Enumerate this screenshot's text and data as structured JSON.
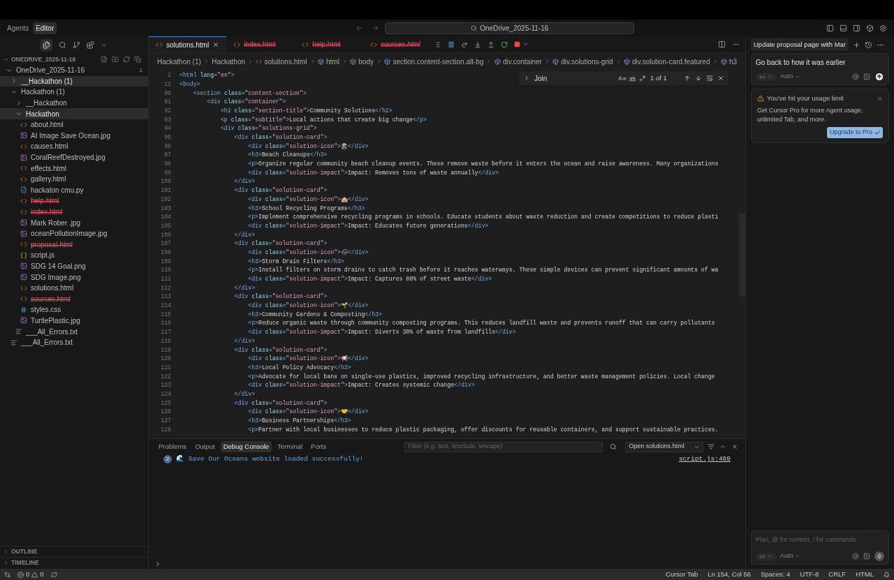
{
  "top_bar": {
    "modes": [
      {
        "label": "Agents",
        "selected": false
      },
      {
        "label": "Editor",
        "selected": true
      }
    ],
    "search": {
      "value": "OneDrive_2025-11-16"
    }
  },
  "explorer": {
    "title": "ONEDRIVE_2025-11-16",
    "tree": [
      {
        "label": "OneDrive_2025-11-16",
        "kind": "folder",
        "expanded": true,
        "selected": false,
        "badge": "1",
        "children": [
          {
            "label": "__Hackathon (1)",
            "kind": "folder",
            "expanded": false,
            "selected": true
          },
          {
            "label": "Hackathon (1)",
            "kind": "folder",
            "expanded": true,
            "selected": false,
            "children": [
              {
                "label": "__Hackathon",
                "kind": "folder",
                "expanded": false,
                "selected": false
              },
              {
                "label": "Hackathon",
                "kind": "folder",
                "expanded": true,
                "selected": true,
                "children": [
                  {
                    "label": "about.html",
                    "kind": "html",
                    "deleted": false,
                    "selected": false
                  },
                  {
                    "label": "AI Image Save Ocean.jpg",
                    "kind": "image",
                    "deleted": false,
                    "selected": false
                  },
                  {
                    "label": "causes.html",
                    "kind": "html",
                    "deleted": false,
                    "selected": false
                  },
                  {
                    "label": "CoralReefDestroyed.jpg",
                    "kind": "image",
                    "deleted": false,
                    "selected": false
                  },
                  {
                    "label": "effects.html",
                    "kind": "html",
                    "deleted": false,
                    "selected": false
                  },
                  {
                    "label": "gallery.html",
                    "kind": "html",
                    "deleted": false,
                    "selected": false
                  },
                  {
                    "label": "hackaton cmu.py",
                    "kind": "python",
                    "deleted": false,
                    "selected": false
                  },
                  {
                    "label": "help.html",
                    "kind": "html",
                    "deleted": true,
                    "selected": false
                  },
                  {
                    "label": "index.html",
                    "kind": "html",
                    "deleted": true,
                    "selected": false
                  },
                  {
                    "label": "Mark Rober .jpg",
                    "kind": "image",
                    "deleted": false,
                    "selected": false
                  },
                  {
                    "label": "oceanPollutionImage.jpg",
                    "kind": "image",
                    "deleted": false,
                    "selected": false
                  },
                  {
                    "label": "proposal.html",
                    "kind": "html",
                    "deleted": true,
                    "selected": false
                  },
                  {
                    "label": "script.js",
                    "kind": "js",
                    "deleted": false,
                    "selected": false
                  },
                  {
                    "label": "SDG 14 Goal.png",
                    "kind": "image",
                    "deleted": false,
                    "selected": false
                  },
                  {
                    "label": "SDG Image.png",
                    "kind": "image",
                    "deleted": false,
                    "selected": false
                  },
                  {
                    "label": "solutions.html",
                    "kind": "html",
                    "deleted": false,
                    "selected": false
                  },
                  {
                    "label": "sources.html",
                    "kind": "html",
                    "deleted": true,
                    "selected": false
                  },
                  {
                    "label": "styles.css",
                    "kind": "css",
                    "deleted": false,
                    "selected": false
                  },
                  {
                    "label": "TurtlePlastic.jpg",
                    "kind": "image",
                    "deleted": false,
                    "selected": false
                  }
                ]
              },
              {
                "label": "___All_Errors.txt",
                "kind": "text",
                "deleted": false,
                "selected": false
              }
            ]
          },
          {
            "label": "___All_Errors.txt",
            "kind": "text",
            "deleted": false,
            "selected": false
          }
        ]
      }
    ]
  },
  "side_sections": [
    {
      "label": "OUTLINE",
      "expanded": false
    },
    {
      "label": "TIMELINE",
      "expanded": false
    }
  ],
  "editor_tabs": [
    {
      "label": "solutions.html",
      "selected": true,
      "deleted": false,
      "preview": false
    },
    {
      "label": "index.html",
      "selected": false,
      "deleted": true,
      "preview": false
    },
    {
      "label": "help.html",
      "selected": false,
      "deleted": true,
      "preview": false
    },
    {
      "label": "sources.html",
      "selected": false,
      "deleted": true,
      "preview": true
    }
  ],
  "breadcrumbs": [
    {
      "label": "Hackathon (1)",
      "kind": "folder"
    },
    {
      "label": "Hackathon",
      "kind": "folder"
    },
    {
      "label": "solutions.html",
      "kind": "file"
    },
    {
      "label": "html",
      "kind": "symbol"
    },
    {
      "label": "body",
      "kind": "symbol"
    },
    {
      "label": "section.content-section.alt-bg",
      "kind": "symbol"
    },
    {
      "label": "div.container",
      "kind": "symbol"
    },
    {
      "label": "div.solutions-grid",
      "kind": "symbol"
    },
    {
      "label": "div.solution-card.featured",
      "kind": "symbol"
    },
    {
      "label": "h3",
      "kind": "symbol"
    }
  ],
  "find": {
    "value": "Join",
    "result": "1 of 1"
  },
  "code_lines": [
    {
      "number": "2",
      "tokens": [
        {
          "kind": "tag",
          "text": "<html"
        },
        {
          "kind": "attr",
          "text": " lang="
        },
        {
          "kind": "str",
          "text": "\"en\""
        },
        {
          "kind": "tag",
          "text": ">"
        }
      ]
    },
    {
      "number": "12",
      "tokens": [
        {
          "kind": "tag",
          "text": "<body>"
        }
      ]
    },
    {
      "number": "90",
      "tokens": [
        {
          "kind": "tag",
          "text": "    <section"
        },
        {
          "kind": "attr",
          "text": " class="
        },
        {
          "kind": "str",
          "text": "\"content-section\""
        },
        {
          "kind": "tag",
          "text": ">"
        }
      ]
    },
    {
      "number": "91",
      "tokens": [
        {
          "kind": "tag",
          "text": "        <div"
        },
        {
          "kind": "attr",
          "text": " class="
        },
        {
          "kind": "str",
          "text": "\"container\""
        },
        {
          "kind": "tag",
          "text": ">"
        }
      ]
    },
    {
      "number": "92",
      "tokens": [
        {
          "kind": "tag",
          "text": "            <h2"
        },
        {
          "kind": "attr",
          "text": " class="
        },
        {
          "kind": "str",
          "text": "\"section-title\""
        },
        {
          "kind": "tag",
          "text": ">"
        },
        {
          "kind": "text",
          "text": "Community Solutions"
        },
        {
          "kind": "tag",
          "text": "</h2>"
        }
      ]
    },
    {
      "number": "93",
      "tokens": [
        {
          "kind": "tag",
          "text": "            <p"
        },
        {
          "kind": "attr",
          "text": " class="
        },
        {
          "kind": "str",
          "text": "\"subtitle\""
        },
        {
          "kind": "tag",
          "text": ">"
        },
        {
          "kind": "text",
          "text": "Local actions that create big change"
        },
        {
          "kind": "tag",
          "text": "</p>"
        }
      ]
    },
    {
      "number": "94",
      "tokens": [
        {
          "kind": "tag",
          "text": "            <div"
        },
        {
          "kind": "attr",
          "text": " class="
        },
        {
          "kind": "str",
          "text": "\"solutions-grid\""
        },
        {
          "kind": "tag",
          "text": ">"
        }
      ]
    },
    {
      "number": "95",
      "tokens": [
        {
          "kind": "tag",
          "text": "                <div"
        },
        {
          "kind": "attr",
          "text": " class="
        },
        {
          "kind": "str",
          "text": "\"solution-card\""
        },
        {
          "kind": "tag",
          "text": ">"
        }
      ]
    },
    {
      "number": "96",
      "tokens": [
        {
          "kind": "tag",
          "text": "                    <div"
        },
        {
          "kind": "attr",
          "text": " class="
        },
        {
          "kind": "str",
          "text": "\"solution-icon\""
        },
        {
          "kind": "tag",
          "text": ">"
        },
        {
          "kind": "text",
          "text": "🏖"
        },
        {
          "kind": "tag",
          "text": "</div>"
        }
      ]
    },
    {
      "number": "97",
      "tokens": [
        {
          "kind": "tag",
          "text": "                    <h3>"
        },
        {
          "kind": "text",
          "text": "Beach Cleanups"
        },
        {
          "kind": "tag",
          "text": "</h3>"
        }
      ]
    },
    {
      "number": "98",
      "tokens": [
        {
          "kind": "tag",
          "text": "                    <p>"
        },
        {
          "kind": "text",
          "text": "Organize regular community beach cleanup events. These remove waste before it enters the ocean and raise awareness. Many organizations"
        }
      ]
    },
    {
      "number": "99",
      "tokens": [
        {
          "kind": "tag",
          "text": "                    <div"
        },
        {
          "kind": "attr",
          "text": " class="
        },
        {
          "kind": "str",
          "text": "\"solution-impact\""
        },
        {
          "kind": "tag",
          "text": ">"
        },
        {
          "kind": "text",
          "text": "Impact: Removes tons of waste annually"
        },
        {
          "kind": "tag",
          "text": "</div>"
        }
      ]
    },
    {
      "number": "100",
      "tokens": [
        {
          "kind": "tag",
          "text": "                </div>"
        }
      ]
    },
    {
      "number": "101",
      "tokens": [
        {
          "kind": "tag",
          "text": "                <div"
        },
        {
          "kind": "attr",
          "text": " class="
        },
        {
          "kind": "str",
          "text": "\"solution-card\""
        },
        {
          "kind": "tag",
          "text": ">"
        }
      ]
    },
    {
      "number": "102",
      "tokens": [
        {
          "kind": "tag",
          "text": "                    <div"
        },
        {
          "kind": "attr",
          "text": " class="
        },
        {
          "kind": "str",
          "text": "\"solution-icon\""
        },
        {
          "kind": "tag",
          "text": ">"
        },
        {
          "kind": "text",
          "text": "🏫"
        },
        {
          "kind": "tag",
          "text": "</div>"
        }
      ]
    },
    {
      "number": "103",
      "tokens": [
        {
          "kind": "tag",
          "text": "                    <h3>"
        },
        {
          "kind": "text",
          "text": "School Recycling Programs"
        },
        {
          "kind": "tag",
          "text": "</h3>"
        }
      ]
    },
    {
      "number": "104",
      "tokens": [
        {
          "kind": "tag",
          "text": "                    <p>"
        },
        {
          "kind": "text",
          "text": "Implement comprehensive recycling programs in schools. Educate students about waste reduction and create competitions to reduce plasti"
        }
      ]
    },
    {
      "number": "105",
      "tokens": [
        {
          "kind": "tag",
          "text": "                    <div"
        },
        {
          "kind": "attr",
          "text": " class="
        },
        {
          "kind": "str",
          "text": "\"solution-impact\""
        },
        {
          "kind": "tag",
          "text": ">"
        },
        {
          "kind": "text",
          "text": "Impact: Educates future generations"
        },
        {
          "kind": "tag",
          "text": "</div>"
        }
      ]
    },
    {
      "number": "106",
      "tokens": [
        {
          "kind": "tag",
          "text": "                </div>"
        }
      ]
    },
    {
      "number": "107",
      "tokens": [
        {
          "kind": "tag",
          "text": "                <div"
        },
        {
          "kind": "attr",
          "text": " class="
        },
        {
          "kind": "str",
          "text": "\"solution-card\""
        },
        {
          "kind": "tag",
          "text": ">"
        }
      ]
    },
    {
      "number": "108",
      "tokens": [
        {
          "kind": "tag",
          "text": "                    <div"
        },
        {
          "kind": "attr",
          "text": " class="
        },
        {
          "kind": "str",
          "text": "\"solution-icon\""
        },
        {
          "kind": "tag",
          "text": ">"
        },
        {
          "kind": "text",
          "text": "🌧"
        },
        {
          "kind": "tag",
          "text": "</div>"
        }
      ]
    },
    {
      "number": "109",
      "tokens": [
        {
          "kind": "tag",
          "text": "                    <h3>"
        },
        {
          "kind": "text",
          "text": "Storm Drain Filters"
        },
        {
          "kind": "tag",
          "text": "</h3>"
        }
      ]
    },
    {
      "number": "110",
      "tokens": [
        {
          "kind": "tag",
          "text": "                    <p>"
        },
        {
          "kind": "text",
          "text": "Install filters on storm drains to catch trash before it reaches waterways. These simple devices can prevent significant amounts of wa"
        }
      ]
    },
    {
      "number": "111",
      "tokens": [
        {
          "kind": "tag",
          "text": "                    <div"
        },
        {
          "kind": "attr",
          "text": " class="
        },
        {
          "kind": "str",
          "text": "\"solution-impact\""
        },
        {
          "kind": "tag",
          "text": ">"
        },
        {
          "kind": "text",
          "text": "Impact: Captures 80% of street waste"
        },
        {
          "kind": "tag",
          "text": "</div>"
        }
      ]
    },
    {
      "number": "112",
      "tokens": [
        {
          "kind": "tag",
          "text": "                </div>"
        }
      ]
    },
    {
      "number": "113",
      "tokens": [
        {
          "kind": "tag",
          "text": "                <div"
        },
        {
          "kind": "attr",
          "text": " class="
        },
        {
          "kind": "str",
          "text": "\"solution-card\""
        },
        {
          "kind": "tag",
          "text": ">"
        }
      ]
    },
    {
      "number": "114",
      "tokens": [
        {
          "kind": "tag",
          "text": "                    <div"
        },
        {
          "kind": "attr",
          "text": " class="
        },
        {
          "kind": "str",
          "text": "\"solution-icon\""
        },
        {
          "kind": "tag",
          "text": ">"
        },
        {
          "kind": "text",
          "text": "🌱"
        },
        {
          "kind": "tag",
          "text": "</div>"
        }
      ]
    },
    {
      "number": "115",
      "tokens": [
        {
          "kind": "tag",
          "text": "                    <h3>"
        },
        {
          "kind": "text",
          "text": "Community Gardens & Composting"
        },
        {
          "kind": "tag",
          "text": "</h3>"
        }
      ]
    },
    {
      "number": "116",
      "tokens": [
        {
          "kind": "tag",
          "text": "                    <p>"
        },
        {
          "kind": "text",
          "text": "Reduce organic waste through community composting programs. This reduces landfill waste and prevents runoff that can carry pollutants"
        }
      ]
    },
    {
      "number": "117",
      "tokens": [
        {
          "kind": "tag",
          "text": "                    <div"
        },
        {
          "kind": "attr",
          "text": " class="
        },
        {
          "kind": "str",
          "text": "\"solution-impact\""
        },
        {
          "kind": "tag",
          "text": ">"
        },
        {
          "kind": "text",
          "text": "Impact: Diverts 30% of waste from landfills"
        },
        {
          "kind": "tag",
          "text": "</div>"
        }
      ]
    },
    {
      "number": "118",
      "tokens": [
        {
          "kind": "tag",
          "text": "                </div>"
        }
      ]
    },
    {
      "number": "119",
      "tokens": [
        {
          "kind": "tag",
          "text": "                <div"
        },
        {
          "kind": "attr",
          "text": " class="
        },
        {
          "kind": "str",
          "text": "\"solution-card\""
        },
        {
          "kind": "tag",
          "text": ">"
        }
      ]
    },
    {
      "number": "120",
      "tokens": [
        {
          "kind": "tag",
          "text": "                    <div"
        },
        {
          "kind": "attr",
          "text": " class="
        },
        {
          "kind": "str",
          "text": "\"solution-icon\""
        },
        {
          "kind": "tag",
          "text": ">"
        },
        {
          "kind": "text",
          "text": "📢"
        },
        {
          "kind": "tag",
          "text": "</div>"
        }
      ]
    },
    {
      "number": "121",
      "tokens": [
        {
          "kind": "tag",
          "text": "                    <h3>"
        },
        {
          "kind": "text",
          "text": "Local Policy Advocacy"
        },
        {
          "kind": "tag",
          "text": "</h3>"
        }
      ]
    },
    {
      "number": "122",
      "tokens": [
        {
          "kind": "tag",
          "text": "                    <p>"
        },
        {
          "kind": "text",
          "text": "Advocate for local bans on single-use plastics, improved recycling infrastructure, and better waste management policies. Local change"
        }
      ]
    },
    {
      "number": "123",
      "tokens": [
        {
          "kind": "tag",
          "text": "                    <div"
        },
        {
          "kind": "attr",
          "text": " class="
        },
        {
          "kind": "str",
          "text": "\"solution-impact\""
        },
        {
          "kind": "tag",
          "text": ">"
        },
        {
          "kind": "text",
          "text": "Impact: Creates systemic change"
        },
        {
          "kind": "tag",
          "text": "</div>"
        }
      ]
    },
    {
      "number": "124",
      "tokens": [
        {
          "kind": "tag",
          "text": "                </div>"
        }
      ]
    },
    {
      "number": "125",
      "tokens": [
        {
          "kind": "tag",
          "text": "                <div"
        },
        {
          "kind": "attr",
          "text": " class="
        },
        {
          "kind": "str",
          "text": "\"solution-card\""
        },
        {
          "kind": "tag",
          "text": ">"
        }
      ]
    },
    {
      "number": "126",
      "tokens": [
        {
          "kind": "tag",
          "text": "                    <div"
        },
        {
          "kind": "attr",
          "text": " class="
        },
        {
          "kind": "str",
          "text": "\"solution-icon\""
        },
        {
          "kind": "tag",
          "text": ">"
        },
        {
          "kind": "text",
          "text": "🤝"
        },
        {
          "kind": "tag",
          "text": "</div>"
        }
      ]
    },
    {
      "number": "127",
      "tokens": [
        {
          "kind": "tag",
          "text": "                    <h3>"
        },
        {
          "kind": "text",
          "text": "Business Partnerships"
        },
        {
          "kind": "tag",
          "text": "</h3>"
        }
      ]
    },
    {
      "number": "128",
      "tokens": [
        {
          "kind": "tag",
          "text": "                    <p>"
        },
        {
          "kind": "text",
          "text": "Partner with local businesses to reduce plastic packaging, offer discounts for reusable containers, and support sustainable practices."
        }
      ]
    }
  ],
  "panel": {
    "tabs": [
      {
        "label": "Problems",
        "selected": false
      },
      {
        "label": "Output",
        "selected": false
      },
      {
        "label": "Debug Console",
        "selected": true
      },
      {
        "label": "Terminal",
        "selected": false
      },
      {
        "label": "Ports",
        "selected": false
      }
    ],
    "filter": {
      "placeholder": "Filter (e.g. text, !exclude, \\escape)"
    },
    "source": "Open solutions.html",
    "messages": [
      {
        "count": "2",
        "text": "🌊 Save Our Oceans website loaded successfully!",
        "link": "script.js:469"
      }
    ]
  },
  "chat": {
    "title": "Update proposal page with Mar",
    "message": "Go back to how it was earlier",
    "model": "Auto",
    "notice": {
      "title": "You've hit your usage limit",
      "body": "Get Cursor Pro for more Agent usage, unlimited Tab, and more.",
      "button": "Upgrade to Pro"
    },
    "input": {
      "placeholder": "Plan, @ for context, / for commands",
      "model": "Auto"
    }
  },
  "status_bar": {
    "errors": "0",
    "warnings": "0",
    "items": [
      "Cursor Tab",
      "Ln 154, Col 56",
      "Spaces: 4",
      "UTF-8",
      "CRLF",
      "HTML"
    ]
  }
}
